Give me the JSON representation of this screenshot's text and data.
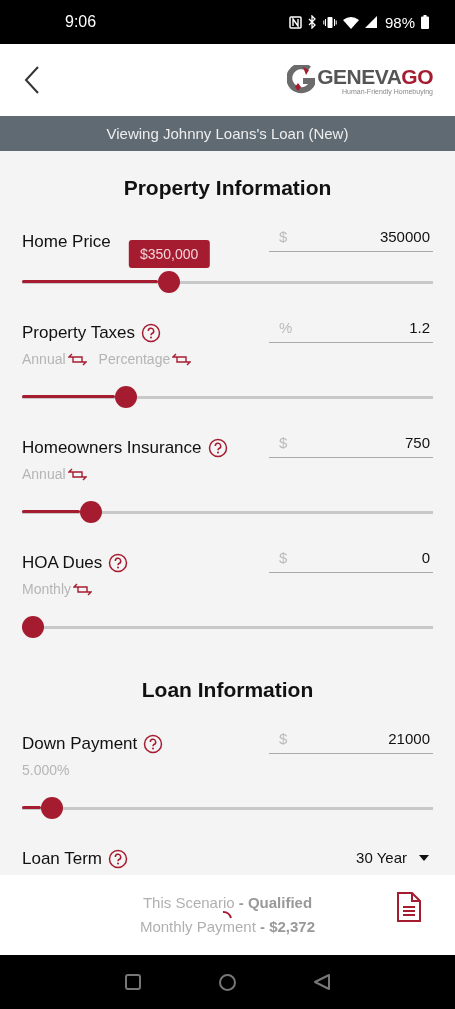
{
  "status_bar": {
    "time": "9:06",
    "battery": "98%"
  },
  "header": {
    "logo": {
      "word": [
        "GENEVA",
        "GO"
      ],
      "tagline": "Human-Friendly Homebuying"
    }
  },
  "banner": "Viewing Johnny Loans's Loan (New)",
  "sections": [
    {
      "title": "Property Information",
      "fields": [
        {
          "kind": "slider",
          "label": "Home Price",
          "help": false,
          "prefix": "$",
          "value": "350000",
          "tooltip": "$350,000",
          "level": 0.35
        },
        {
          "kind": "slider",
          "label": "Property Taxes",
          "help": true,
          "options": [
            {
              "kind": "toggle",
              "label": "Annual"
            },
            {
              "kind": "toggle",
              "label": "Percentage"
            }
          ],
          "prefix": "%",
          "value": "1.2",
          "level": 0.24
        },
        {
          "kind": "slider",
          "label": "Homeowners Insurance",
          "help": true,
          "options": [
            {
              "kind": "toggle",
              "label": "Annual"
            }
          ],
          "prefix": "$",
          "value": "750",
          "level": 0.15
        },
        {
          "kind": "slider",
          "label": "HOA Dues",
          "help": true,
          "options": [
            {
              "kind": "toggle",
              "label": "Monthly"
            }
          ],
          "prefix": "$",
          "value": "0",
          "level": 0
        }
      ]
    },
    {
      "title": "Loan Information",
      "fields": [
        {
          "kind": "slider",
          "label": "Down Payment",
          "help": true,
          "options": [
            {
              "kind": "note",
              "label": "5.000%"
            }
          ],
          "prefix": "$",
          "value": "21000",
          "level": 0.05
        },
        {
          "kind": "dropdown",
          "label": "Loan Term",
          "help": true,
          "value": "30 Year"
        }
      ]
    }
  ],
  "footer": {
    "scenario": "This Scenario **- Qualified**",
    "payment": "Monthly Payment **- $2,372**"
  }
}
